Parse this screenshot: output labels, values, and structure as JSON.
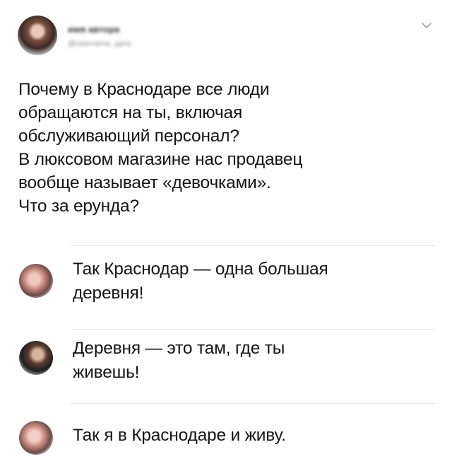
{
  "tweet": {
    "author_name": "имя автора",
    "author_handle": "@username, дата",
    "lines": [
      "Почему в Краснодаре все люди",
      "обращаются на ты, включая",
      "обслуживающий персонал?",
      "В люксовом магазине нас продавец",
      "вообще называет «девочками».",
      "Что за ерунда?"
    ]
  },
  "replies": [
    {
      "lines": [
        "Так Краснодар — одна большая",
        "деревня!"
      ]
    },
    {
      "lines": [
        "Деревня — это там, где ты",
        "живешь!"
      ]
    },
    {
      "lines": [
        "Так я в Краснодаре и живу."
      ]
    }
  ],
  "icons": {
    "menu": "chevron-down-icon"
  },
  "colors": {
    "text": "#141414",
    "divider": "#e6e6e6",
    "chevron": "#9aa3ab"
  }
}
